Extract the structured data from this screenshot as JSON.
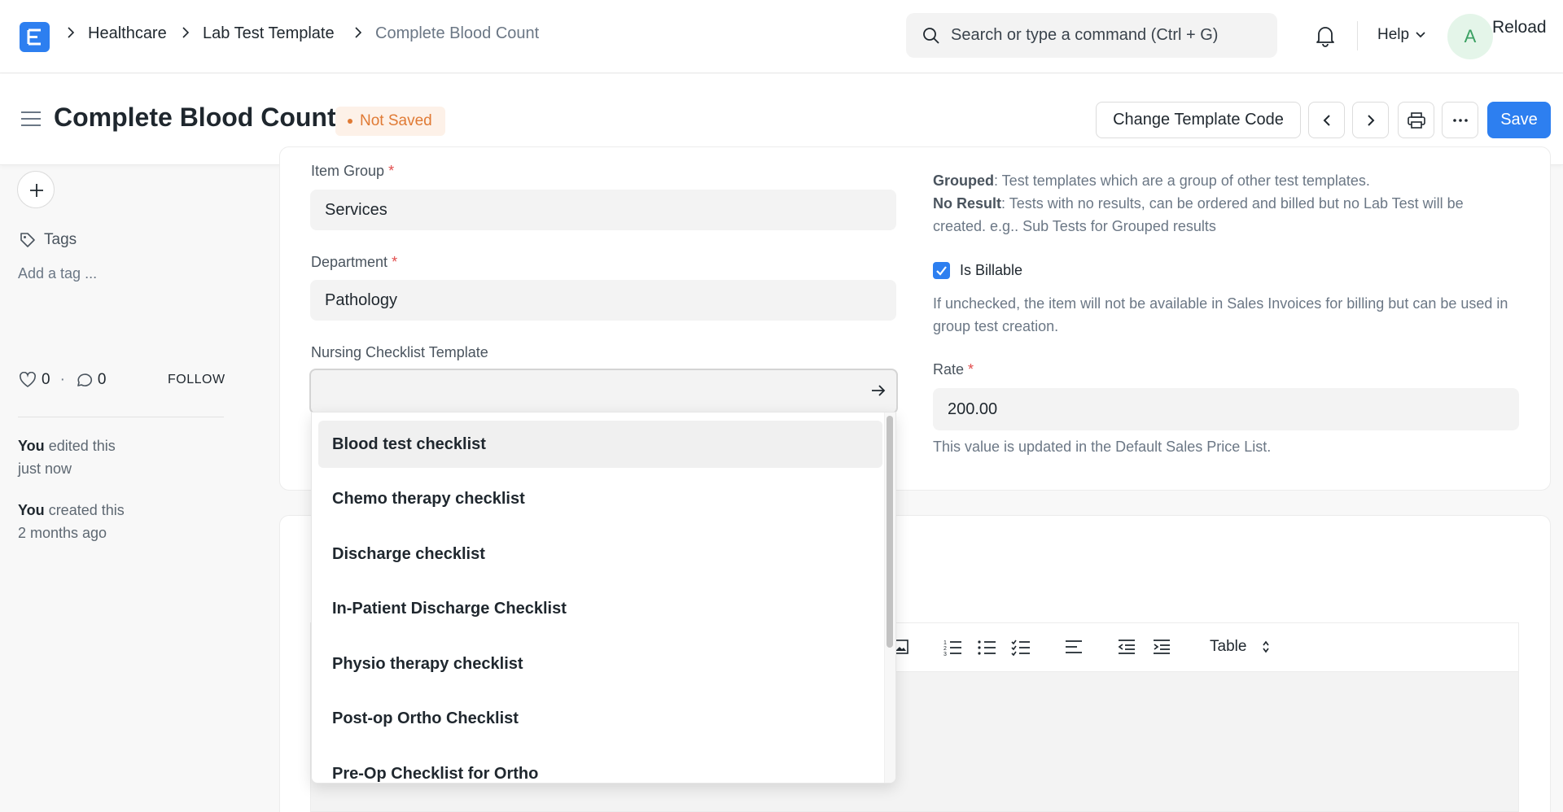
{
  "breadcrumbs": [
    "Healthcare",
    "Lab Test Template",
    "Complete Blood Count"
  ],
  "search": {
    "placeholder": "Search or type a command (Ctrl + G)"
  },
  "navbar": {
    "help_label": "Help",
    "avatar_initial": "A",
    "reload_label": "Reload"
  },
  "page": {
    "title": "Complete Blood Count",
    "status_badge": "Not Saved",
    "actions": {
      "change_template_code": "Change Template Code",
      "save": "Save"
    }
  },
  "sidebar": {
    "tags_label": "Tags",
    "add_tag": "Add a tag ...",
    "likes_count": "0",
    "comments_count": "0",
    "follow_label": "FOLLOW",
    "activity": [
      {
        "actor": "You",
        "action": "edited this",
        "time": "just now"
      },
      {
        "actor": "You",
        "action": "created this",
        "time": "2 months ago"
      }
    ]
  },
  "form": {
    "item_group": {
      "label": "Item Group",
      "value": "Services"
    },
    "department": {
      "label": "Department",
      "value": "Pathology"
    },
    "nursing_checklist": {
      "label": "Nursing Checklist Template",
      "value": ""
    },
    "type_help": {
      "grouped_term": "Grouped",
      "grouped_desc": ": Test templates which are a group of other test templates.",
      "no_result_term": "No Result",
      "no_result_desc": ": Tests with no results, can be ordered and billed but no Lab Test will be created. e.g.. Sub Tests for Grouped results"
    },
    "is_billable": {
      "label": "Is Billable",
      "checked": true,
      "help": "If unchecked, the item will not be available in Sales Invoices for billing but can be used in group test creation."
    },
    "rate": {
      "label": "Rate",
      "value": "200.00",
      "help": "This value is updated in the Default Sales Price List."
    }
  },
  "dropdown_options": [
    "Blood test checklist",
    "Chemo therapy checklist",
    "Discharge checklist",
    "In-Patient Discharge Checklist",
    "Physio therapy checklist",
    "Post-op Ortho Checklist",
    "Pre-Op Checklist for Ortho"
  ],
  "editor": {
    "table_label": "Table"
  },
  "colors": {
    "primary": "#2d7ff0",
    "warning": "#e07a34",
    "required": "#e24c4c"
  }
}
